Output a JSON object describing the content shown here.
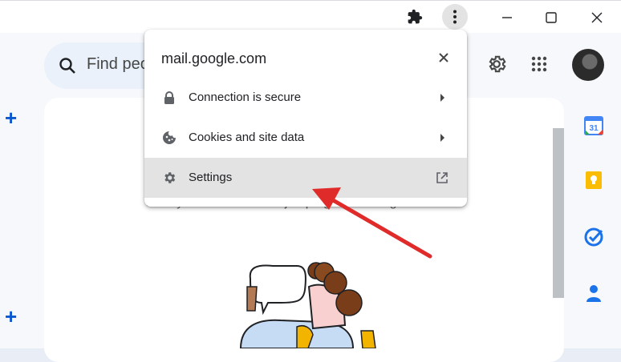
{
  "page_title_bar": {
    "extensions_icon": "puzzle-icon",
    "menu_icon": "vertical-dots-icon",
    "minimize_icon": "minimize-icon",
    "maximize_icon": "maximize-icon",
    "close_icon": "close-icon"
  },
  "gmail": {
    "search_placeholder": "Find peo",
    "behind_text": "Ready? Set. Chat! Let's jump right into things.",
    "right_icons": [
      "gear-icon",
      "apps-grid-icon"
    ],
    "rail": {
      "calendar_date": "31",
      "items": [
        "calendar-icon",
        "keep-icon",
        "tasks-icon",
        "contacts-icon"
      ]
    }
  },
  "site_info_popup": {
    "domain": "mail.google.com",
    "rows": [
      {
        "label": "Connection is secure",
        "icon": "lock-icon",
        "trailing": "chevron-right"
      },
      {
        "label": "Cookies and site data",
        "icon": "cookie-icon",
        "trailing": "chevron-right"
      },
      {
        "label": "Settings",
        "icon": "settings-icon",
        "trailing": "open-external"
      }
    ],
    "highlighted_row": "Settings"
  },
  "annotation": {
    "arrow_color": "#e02b2b"
  },
  "colors": {
    "accent_blue": "#0b57d0",
    "row_highlight": "#e3e3e3"
  }
}
